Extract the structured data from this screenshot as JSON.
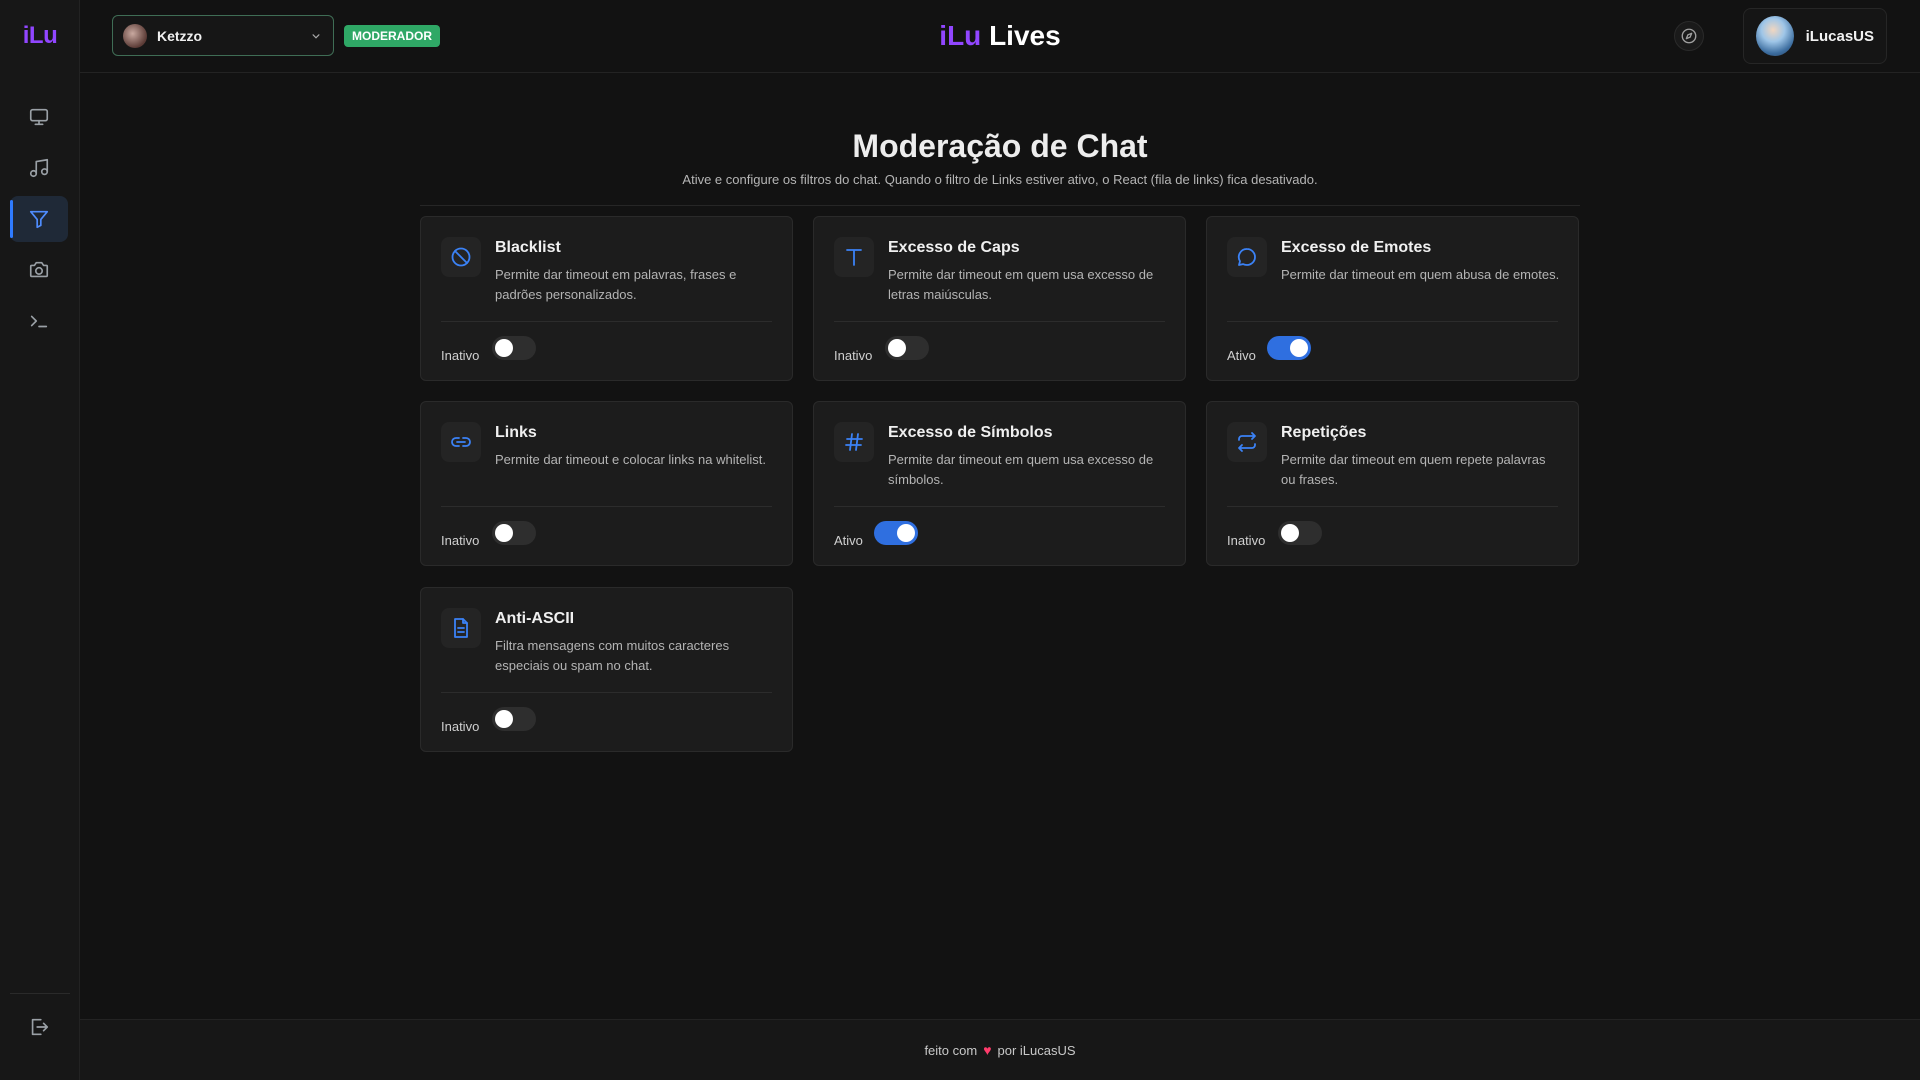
{
  "sidebar": {
    "logo": "iLu",
    "items": [
      {
        "name": "monitor-icon",
        "active": false
      },
      {
        "name": "music-icon",
        "active": false
      },
      {
        "name": "filter-icon",
        "active": true
      },
      {
        "name": "camera-icon",
        "active": false
      },
      {
        "name": "terminal-icon",
        "active": false
      }
    ],
    "bottom": {
      "name": "logout-icon"
    }
  },
  "header": {
    "channel": "Ketzzo",
    "role": "MODERADOR",
    "brand_1": "iLu",
    "brand_2": "Lives",
    "user": "iLucasUS"
  },
  "main": {
    "title": "Moderação de Chat",
    "subtitle": "Ative e configure os filtros do chat. Quando o filtro de Links estiver ativo, o React (fila de links) fica desativado.",
    "cards": [
      {
        "title": "Blacklist",
        "desc": "Permite dar timeout em palavras, frases e padrões personalizados.",
        "status": "Inativo",
        "on": false,
        "icon": "ban-icon"
      },
      {
        "title": "Excesso de Caps",
        "desc": "Permite dar timeout em quem usa excesso de letras maiúsculas.",
        "status": "Inativo",
        "on": false,
        "icon": "text-icon"
      },
      {
        "title": "Excesso de Emotes",
        "desc": "Permite dar timeout em quem abusa de emotes.",
        "status": "Ativo",
        "on": true,
        "icon": "chat-bubble-icon"
      },
      {
        "title": "Links",
        "desc": "Permite dar timeout e colocar links na whitelist.",
        "status": "Inativo",
        "on": false,
        "icon": "link-icon"
      },
      {
        "title": "Excesso de Símbolos",
        "desc": "Permite dar timeout em quem usa excesso de símbolos.",
        "status": "Ativo",
        "on": true,
        "icon": "hash-icon"
      },
      {
        "title": "Repetições",
        "desc": "Permite dar timeout em quem repete palavras ou frases.",
        "status": "Inativo",
        "on": false,
        "icon": "repeat-icon"
      },
      {
        "title": "Anti-ASCII",
        "desc": "Filtra mensagens com muitos caracteres especiais ou spam no chat.",
        "status": "Inativo",
        "on": false,
        "icon": "document-icon"
      }
    ]
  },
  "footer": {
    "prefix": "feito com",
    "suffix": "por iLucasUS"
  },
  "colors": {
    "accent": "#2f6fe0",
    "brand": "#9146ff",
    "badge": "#2fa866",
    "heart": "#ff3b6b"
  }
}
